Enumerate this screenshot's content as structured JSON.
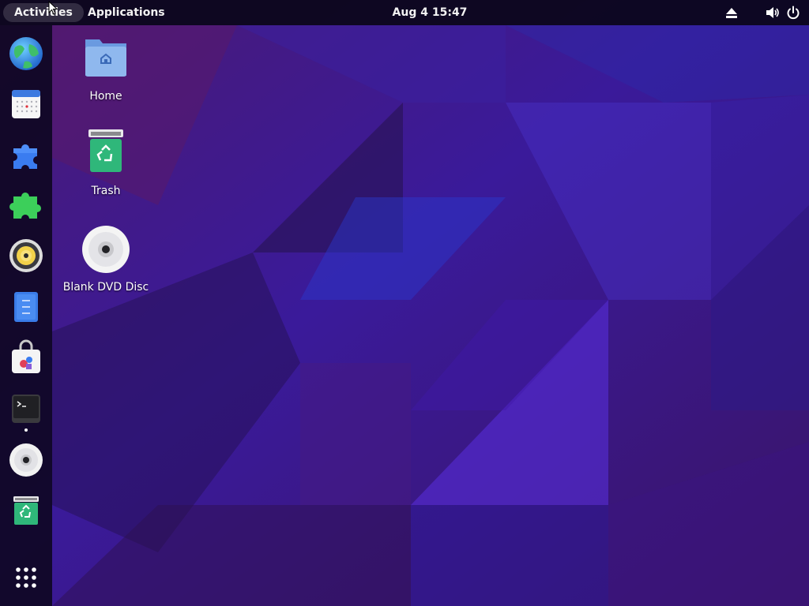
{
  "topbar": {
    "activities_label": "Activities",
    "applications_label": "Applications",
    "clock": "Aug 4  15:47",
    "tray_icons": [
      "eject-icon",
      "volume-icon",
      "power-icon"
    ]
  },
  "dock": {
    "items": [
      {
        "name": "web-browser",
        "icon": "globe-icon"
      },
      {
        "name": "calendar",
        "icon": "calendar-icon"
      },
      {
        "name": "extensions",
        "icon": "puzzle-blue-icon"
      },
      {
        "name": "extension-manager",
        "icon": "puzzle-green-icon"
      },
      {
        "name": "music-player",
        "icon": "speaker-icon"
      },
      {
        "name": "text-editor",
        "icon": "document-icon"
      },
      {
        "name": "software",
        "icon": "shopping-bag-icon"
      },
      {
        "name": "terminal",
        "icon": "terminal-icon",
        "running": true
      },
      {
        "name": "dvd-disc",
        "icon": "disc-icon"
      },
      {
        "name": "trash",
        "icon": "trash-icon"
      }
    ],
    "app_grid": "app-grid-icon"
  },
  "desktop": {
    "icons": [
      {
        "label": "Home",
        "icon": "home-folder-icon"
      },
      {
        "label": "Trash",
        "icon": "trash-icon"
      },
      {
        "label": "Blank DVD Disc",
        "icon": "disc-icon"
      }
    ]
  },
  "colors": {
    "wallpaper_base": "#3a1780",
    "wallpaper_accent": "#5a2ad8",
    "panel": "#0c061e",
    "folder_blue": "#8fb8ee",
    "trash_green": "#2fb77a"
  }
}
